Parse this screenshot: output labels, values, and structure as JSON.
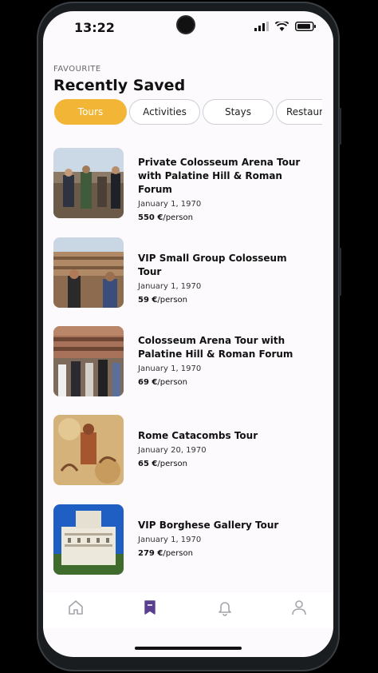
{
  "status": {
    "time": "13:22"
  },
  "header": {
    "eyebrow": "FAVOURITE",
    "title": "Recently Saved"
  },
  "tabs": [
    {
      "label": "Tours",
      "active": true
    },
    {
      "label": "Activities",
      "active": false
    },
    {
      "label": "Stays",
      "active": false
    },
    {
      "label": "Restaurants",
      "active": false
    }
  ],
  "items": [
    {
      "title": "Private Colosseum Arena Tour with Palatine Hill & Roman Forum",
      "date": "January 1, 1970",
      "price": "550 €",
      "unit": "/person"
    },
    {
      "title": "VIP Small Group Colosseum Tour",
      "date": "January 1, 1970",
      "price": "59 €",
      "unit": "/person"
    },
    {
      "title": "Colosseum Arena Tour with Palatine Hill & Roman Forum",
      "date": "January 1, 1970",
      "price": "69 €",
      "unit": "/person"
    },
    {
      "title": "Rome Catacombs Tour",
      "date": "January 20, 1970",
      "price": "65 €",
      "unit": "/person"
    },
    {
      "title": "VIP Borghese Gallery Tour",
      "date": "January 1, 1970",
      "price": "279 €",
      "unit": "/person"
    }
  ],
  "nav": [
    "home-icon",
    "bookmark-icon",
    "bell-icon",
    "user-icon"
  ],
  "colors": {
    "accent": "#f2b535",
    "nav_active": "#5a3f8f",
    "nav_inactive": "#a4a4ac"
  }
}
